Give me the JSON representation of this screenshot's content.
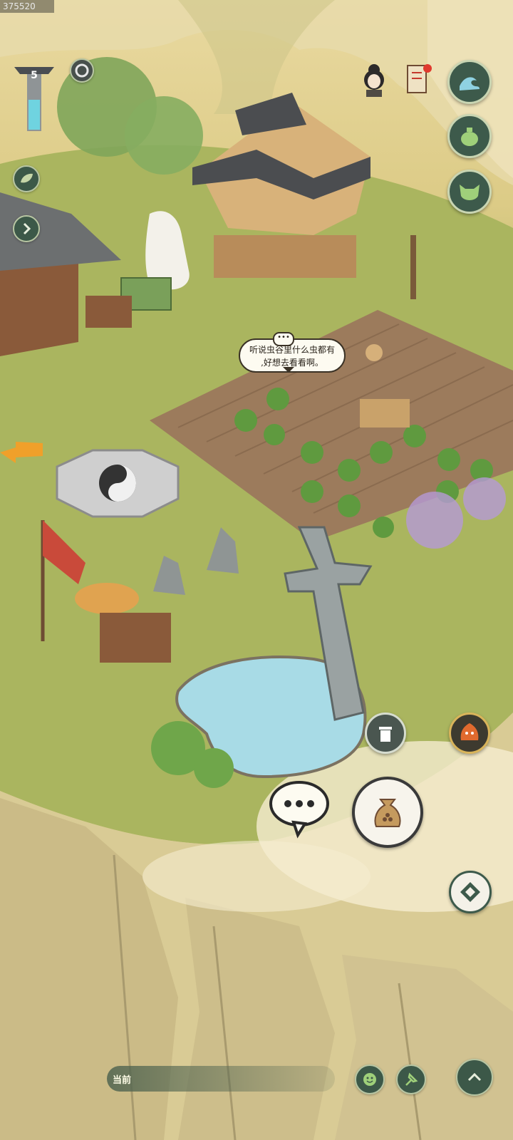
{
  "build_id": "375520",
  "level_indicator": {
    "value": "5"
  },
  "npc_speech": {
    "line1": "听说虫谷里什么虫都有",
    "line2": ",好想去看看啊。"
  },
  "bottom_bar": {
    "current_label": "当前"
  },
  "icons": {
    "refresh": "refresh-ring-icon",
    "leaf": "leaf-icon",
    "expand": "chevron-right-icon",
    "character": "character-portrait-icon",
    "notice": "scroll-notice-icon",
    "wave": "wave-icon",
    "pot": "pot-icon",
    "cat": "cat-mask-icon",
    "monster": "fire-demon-icon",
    "trash": "trash-icon",
    "chat": "chat-bubble-icon",
    "bag": "seed-bag-icon",
    "compass": "compass-icon",
    "emoji": "smiley-icon",
    "pin": "pin-icon",
    "up": "chevron-up-icon"
  },
  "colors": {
    "button_bg": "#3d5a4b",
    "button_border": "#c9d5b2",
    "grass": "#a9b35e",
    "field": "#9c7b5c",
    "pond": "#a8dbe6"
  }
}
